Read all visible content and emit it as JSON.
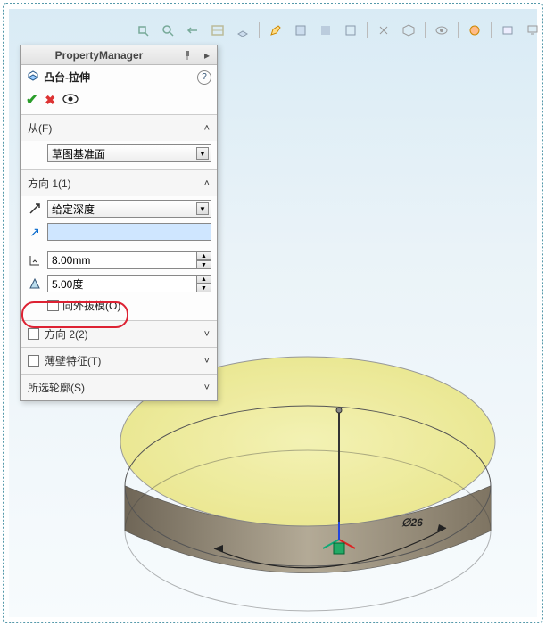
{
  "header": {
    "title": "PropertyManager"
  },
  "feature": {
    "name": "凸台-拉伸"
  },
  "from": {
    "label": "从(F)",
    "sketch_plane": "草图基准面"
  },
  "dir1": {
    "label": "方向 1(1)",
    "end_condition": "给定深度",
    "selection": "",
    "depth": "8.00mm",
    "draft": "5.00度",
    "outward_draft_label": "向外拔模(O)"
  },
  "dir2": {
    "label": "方向 2(2)"
  },
  "thin": {
    "label": "薄壁特征(T)"
  },
  "contours": {
    "label": "所选轮廓(S)"
  },
  "dim_label": "∅26",
  "icons": {
    "feature": "extrude-boss",
    "reverse": "reverse-direction",
    "depth": "depth",
    "draft": "draft-angle"
  }
}
